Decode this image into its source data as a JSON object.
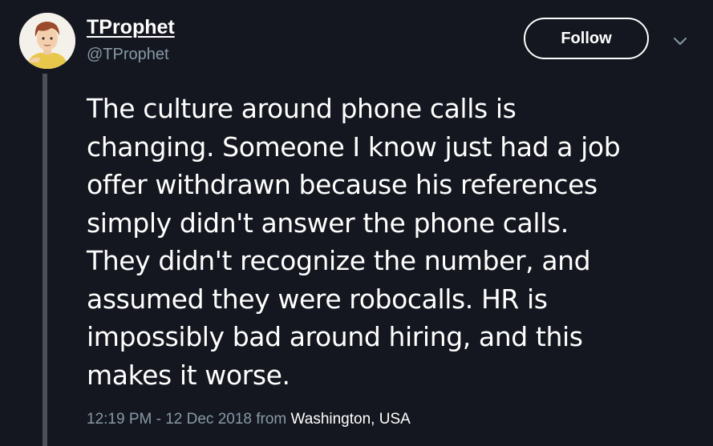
{
  "user": {
    "display_name": "TProphet",
    "handle": "@TProphet",
    "avatar_caption": "TProphet"
  },
  "actions": {
    "follow_label": "Follow",
    "menu_icon": "chevron-down-icon"
  },
  "tweet": {
    "text": "The culture around phone calls is\nchanging. Someone I know just had a job\noffer withdrawn because his references\nsimply didn't answer the phone calls.\nThey didn't recognize the number, and\nassumed they were robocalls. HR is\nimpossibly bad around hiring, and this\nmakes it worse.",
    "timestamp": "12:19 PM - 12 Dec 2018",
    "from_label": "from",
    "location": "Washington, USA"
  },
  "colors": {
    "background": "#14171f",
    "text": "#ffffff",
    "muted": "#8899a6",
    "thread_line": "#4a4f58"
  }
}
